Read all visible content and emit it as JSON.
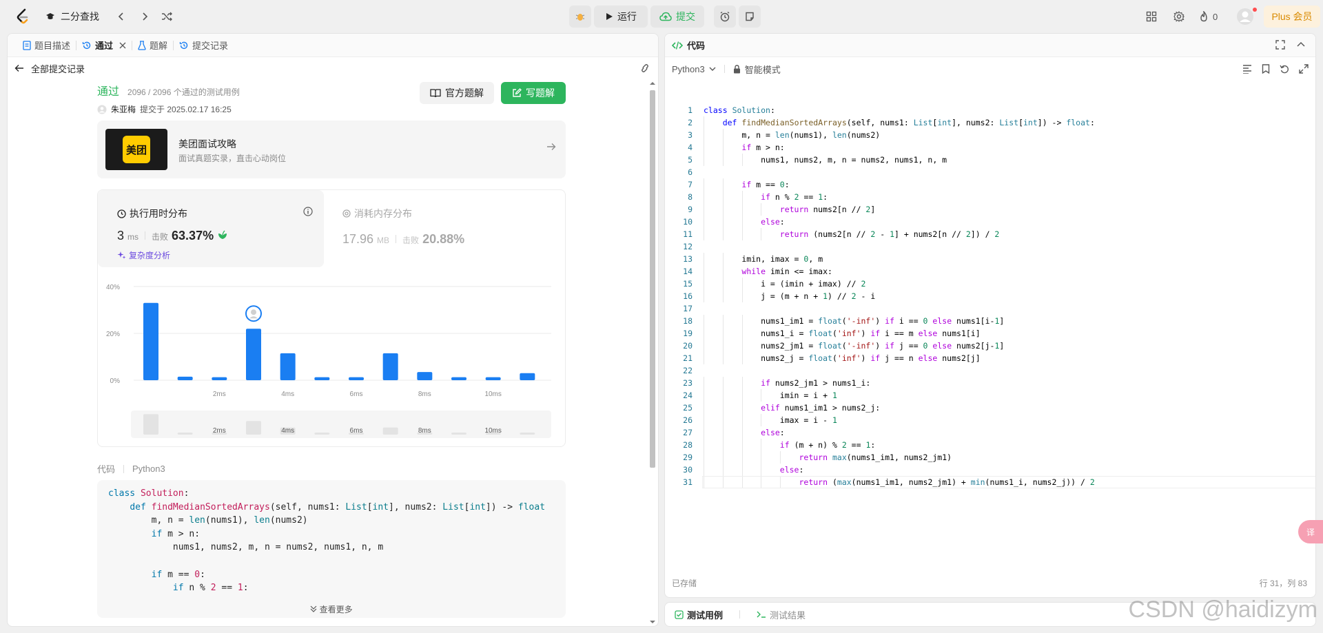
{
  "nav": {
    "problem_title": "二分查找",
    "run_label": "运行",
    "submit_label": "提交",
    "fire_count": "0",
    "plus_label": "Plus 会员"
  },
  "left": {
    "tabs": [
      {
        "label": "题目描述"
      },
      {
        "label": "通过"
      },
      {
        "label": "题解"
      },
      {
        "label": "提交记录"
      }
    ],
    "back_label": "全部提交记录",
    "status": "通过",
    "cases": "2096 / 2096 个通过的测试用例",
    "user": "朱亚梅",
    "submitted_at": "提交于 2025.02.17 16:25",
    "official_btn": "官方题解",
    "write_btn": "写题解",
    "banner": {
      "thumb_text": "美团",
      "title": "美团面试攻略",
      "subtitle": "面试真题实录，直击心动岗位"
    },
    "runtime": {
      "title": "执行用时分布",
      "value": "3",
      "unit": "ms",
      "beat_label": "击败",
      "percent": "63.37%",
      "complexity": "复杂度分析"
    },
    "memory": {
      "title": "消耗内存分布",
      "value": "17.96",
      "unit": "MB",
      "beat_label": "击败",
      "percent": "20.88%"
    },
    "code_label": "代码",
    "code_lang": "Python3",
    "more_label": "查看更多",
    "code_lines": [
      "class Solution:",
      "    def findMedianSortedArrays(self, nums1: List[int], nums2: List[int]) -> float",
      "        m, n = len(nums1), len(nums2)",
      "        if m > n:",
      "            nums1, nums2, m, n = nums2, nums1, n, m",
      "",
      "        if m == 0:",
      "            if n % 2 == 1:"
    ]
  },
  "chart_data": {
    "type": "bar",
    "title": "",
    "xlabel": "",
    "ylabel": "",
    "ylim": [
      0,
      40
    ],
    "y_ticks": [
      "0%",
      "20%",
      "40%"
    ],
    "x_tick_labels": [
      "2ms",
      "4ms",
      "6ms",
      "8ms",
      "10ms"
    ],
    "categories": [
      "0ms",
      "1ms",
      "2ms",
      "3ms",
      "4ms",
      "5ms",
      "6ms",
      "7ms",
      "8ms",
      "9ms",
      "10ms",
      "11ms"
    ],
    "values": [
      33,
      1.5,
      1.3,
      22,
      11.5,
      1.3,
      1.3,
      11.5,
      3.5,
      1.3,
      1.3,
      3
    ],
    "highlight_index": 3,
    "colors": {
      "bar": "#1a7ef2",
      "grid": "#e8e8e8"
    }
  },
  "right": {
    "title": "代码",
    "lang": "Python3",
    "mode": "智能模式",
    "saved": "已存储",
    "cursor": "行 31，列 83",
    "tab_testcase": "测试用例",
    "tab_result": "测试结果",
    "lines": [
      "class Solution:",
      "    def findMedianSortedArrays(self, nums1: List[int], nums2: List[int]) -> float:",
      "        m, n = len(nums1), len(nums2)",
      "        if m > n:",
      "            nums1, nums2, m, n = nums2, nums1, n, m",
      "",
      "        if m == 0:",
      "            if n % 2 == 1:",
      "                return nums2[n // 2]",
      "            else:",
      "                return (nums2[n // 2 - 1] + nums2[n // 2]) / 2",
      "",
      "        imin, imax = 0, m",
      "        while imin <= imax:",
      "            i = (imin + imax) // 2",
      "            j = (m + n + 1) // 2 - i",
      "",
      "            nums1_im1 = float('-inf') if i == 0 else nums1[i-1]",
      "            nums1_i = float('inf') if i == m else nums1[i]",
      "            nums2_jm1 = float('-inf') if j == 0 else nums2[j-1]",
      "            nums2_j = float('inf') if j == n else nums2[j]",
      "",
      "            if nums2_jm1 > nums1_i:",
      "                imin = i + 1",
      "            elif nums1_im1 > nums2_j:",
      "                imax = i - 1",
      "            else:",
      "                if (m + n) % 2 == 1:",
      "                    return max(nums1_im1, nums2_jm1)",
      "                else:",
      "                    return (max(nums1_im1, nums2_jm1) + min(nums1_i, nums2_j)) / 2"
    ]
  },
  "float_badge": "译",
  "watermark": "CSDN @haidizym"
}
